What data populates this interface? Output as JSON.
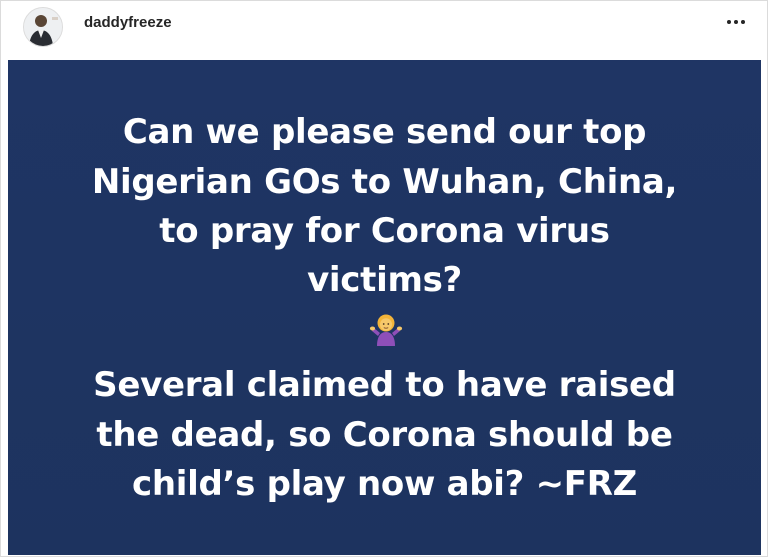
{
  "header": {
    "username": "daddyfreeze",
    "more_icon": "more-horizontal-icon"
  },
  "post_image": {
    "background_color": "#1f3564",
    "text_color": "#ffffff",
    "lines": [
      "Can we please send our top",
      "Nigerian GOs to Wuhan, China,",
      "to pray for Corona virus",
      "victims?",
      "Several claimed to have raised",
      "the dead, so Corona should be",
      "child’s play now abi? ~FRZ"
    ],
    "emoji": "person-shrugging-emoji"
  }
}
